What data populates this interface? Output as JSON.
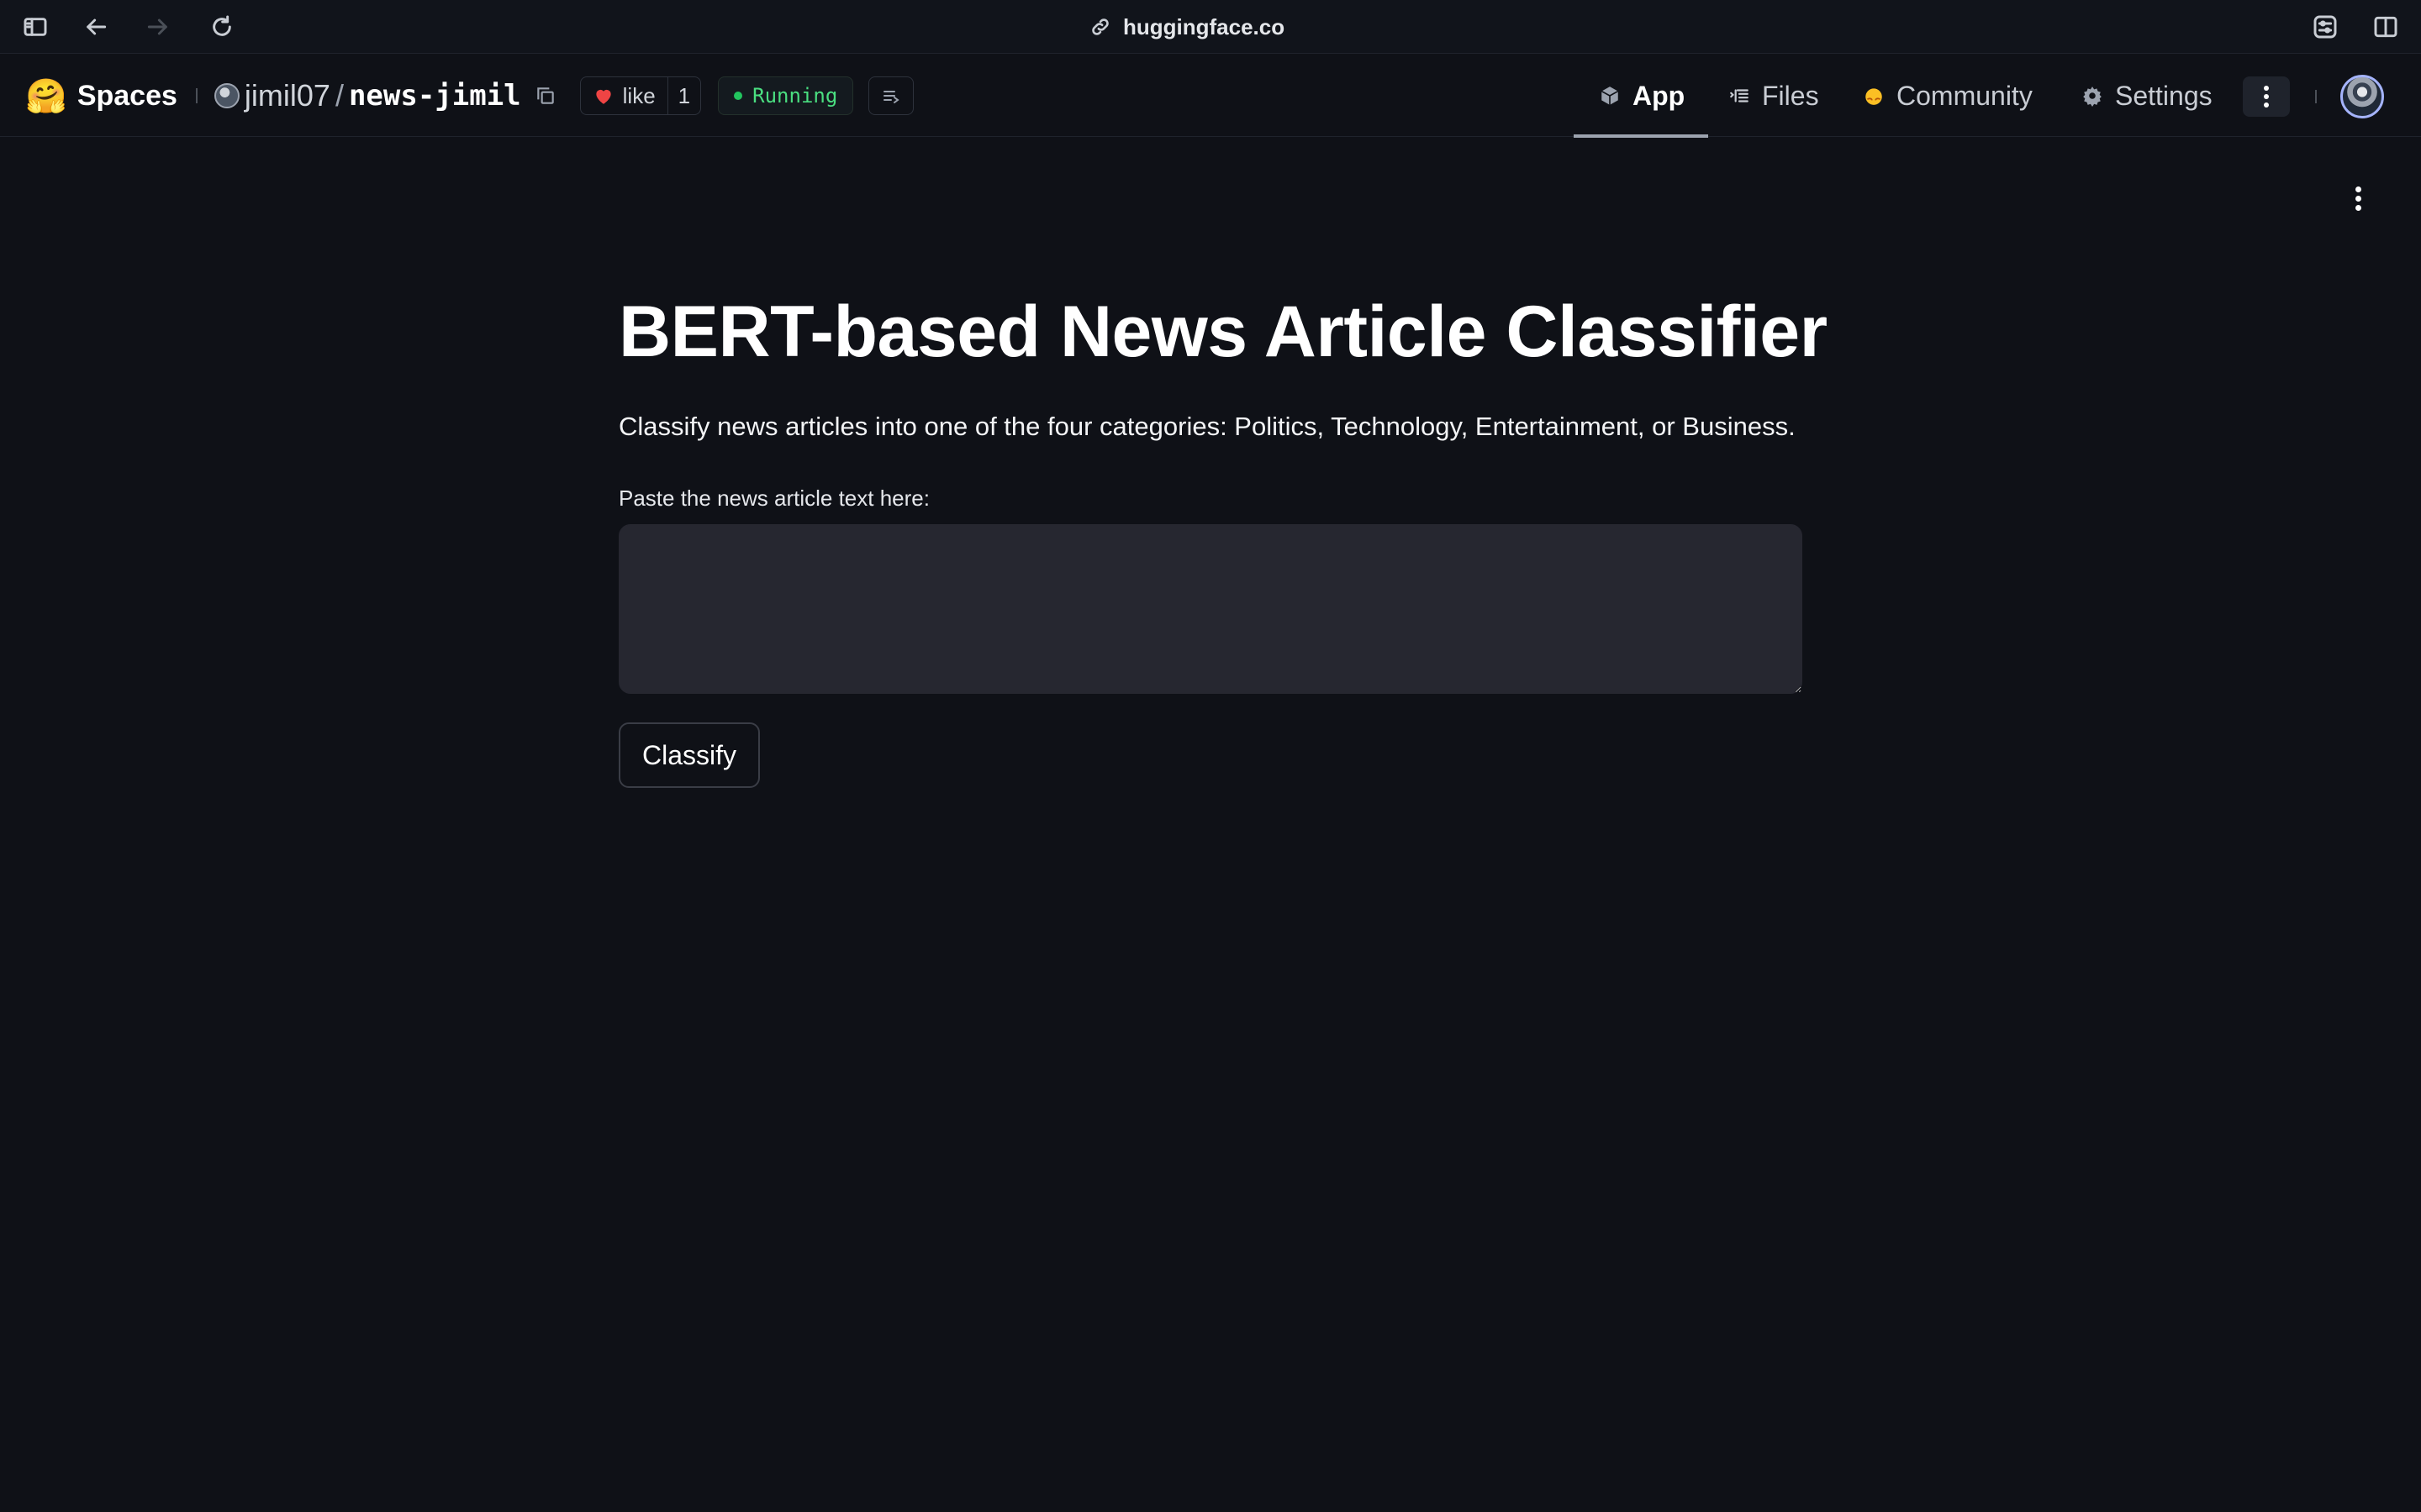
{
  "browser": {
    "url": "huggingface.co"
  },
  "header": {
    "brand_label": "Spaces",
    "brand_emoji": "🤗",
    "owner": "jimil07",
    "separator": "/",
    "repo": "news-jimil",
    "like_label": "like",
    "like_count": "1",
    "status": "Running",
    "status_color": "#22c55e",
    "tabs": [
      {
        "label": "App",
        "icon": "cube-icon",
        "active": true
      },
      {
        "label": "Files",
        "icon": "files-icon",
        "active": false
      },
      {
        "label": "Community",
        "icon": "hf-community-icon",
        "active": false
      },
      {
        "label": "Settings",
        "icon": "gear-icon",
        "active": false
      }
    ]
  },
  "app": {
    "title": "BERT-based News Article Classifier",
    "description": "Classify news articles into one of the four categories: Politics, Technology, Entertainment, or Business.",
    "input_label": "Paste the news article text here:",
    "input_value": "",
    "button_label": "Classify"
  }
}
